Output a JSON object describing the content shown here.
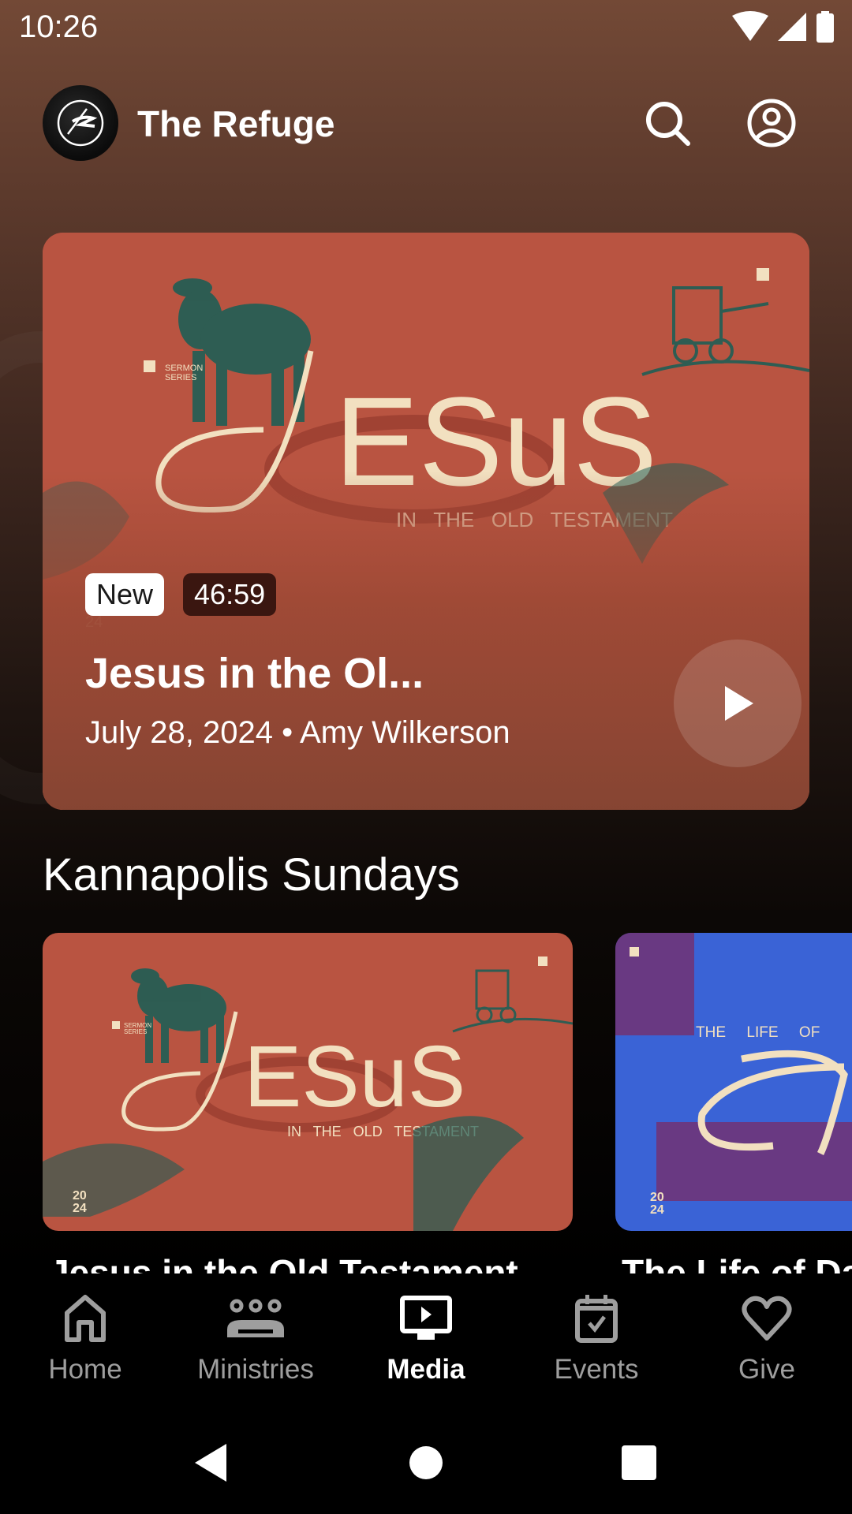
{
  "status_bar": {
    "time": "10:26",
    "icons": [
      "wifi-icon",
      "cellular-signal-icon",
      "battery-icon"
    ]
  },
  "header": {
    "title": "The Refuge",
    "logo_icon": "church-logo",
    "actions": [
      {
        "name": "search",
        "icon": "search-icon"
      },
      {
        "name": "account",
        "icon": "account-circle-icon"
      }
    ]
  },
  "hero": {
    "artwork": {
      "series_label_line1": "SERMON",
      "series_label_line2": "SERIES",
      "headline": "JESUS",
      "subhead": "IN   THE   OLD   TESTAMENT",
      "year_line2": "24"
    },
    "badge_new": "New",
    "duration": "46:59",
    "title": "Jesus in the Ol...",
    "meta": "July 28, 2024 • Amy Wilkerson",
    "play_icon": "play-icon",
    "colors": {
      "art_bg": "#b95441",
      "art_text": "#f2e0c0",
      "art_ink": "#1f5e55"
    }
  },
  "section": {
    "title": "Kannapolis Sundays",
    "cards": [
      {
        "title": "Jesus in the Old Testament",
        "artwork": {
          "series_line1": "SERMON",
          "series_line2": "SERIES",
          "headline": "JESUS",
          "subhead": "IN   THE   OLD   TESTAMENT",
          "year_line1": "20",
          "year_line2": "24",
          "bg": "#b95441"
        }
      },
      {
        "title": "The Life of David",
        "artwork": {
          "top_line": "THE     LIFE     OF",
          "headline": "D",
          "year_line1": "20",
          "year_line2": "24",
          "bg": "#3a63d6"
        }
      }
    ]
  },
  "bottom_nav": {
    "active": "Media",
    "items": [
      {
        "label": "Home",
        "icon": "home-icon"
      },
      {
        "label": "Ministries",
        "icon": "groups-icon"
      },
      {
        "label": "Media",
        "icon": "media-play-icon"
      },
      {
        "label": "Events",
        "icon": "calendar-check-icon"
      },
      {
        "label": "Give",
        "icon": "heart-icon"
      }
    ]
  },
  "system_nav": {
    "buttons": [
      "back",
      "home",
      "recents"
    ]
  }
}
